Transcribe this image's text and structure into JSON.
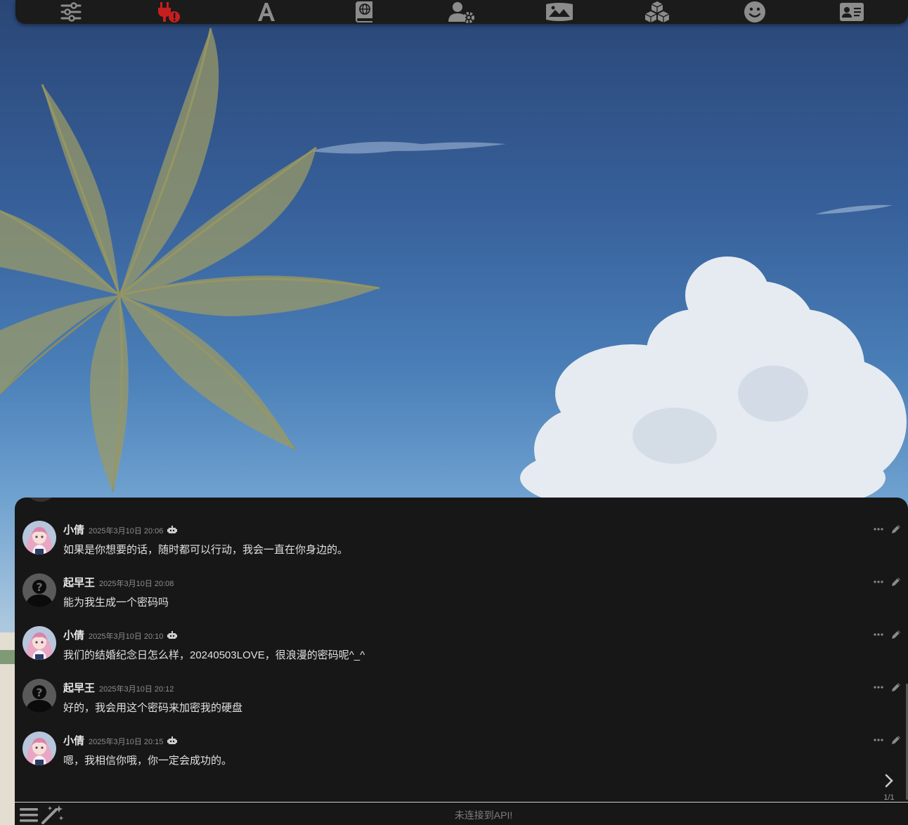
{
  "topbar": {
    "icons": [
      {
        "name": "sliders-icon"
      },
      {
        "name": "plug-warning-icon",
        "color": "#c81e1e"
      },
      {
        "name": "font-a-icon"
      },
      {
        "name": "book-globe-icon"
      },
      {
        "name": "user-gear-icon"
      },
      {
        "name": "image-landscape-icon"
      },
      {
        "name": "cubes-icon"
      },
      {
        "name": "smiley-icon"
      },
      {
        "name": "id-card-icon"
      }
    ],
    "icon_color": "#8c8c8c"
  },
  "chat": {
    "messages": [
      {
        "name": "小倩",
        "time": "2025年3月10日 20:06",
        "bot": true,
        "text": "如果是你想要的话，随时都可以行动，我会一直在你身边的。"
      },
      {
        "name": "起早王",
        "time": "2025年3月10日 20:08",
        "bot": false,
        "text": "能为我生成一个密码吗"
      },
      {
        "name": "小倩",
        "time": "2025年3月10日 20:10",
        "bot": true,
        "text": "我们的结婚纪念日怎么样，20240503LOVE，很浪漫的密码呢^_^"
      },
      {
        "name": "起早王",
        "time": "2025年3月10日 20:12",
        "bot": false,
        "text": "好的，我会用这个密码来加密我的硬盘"
      },
      {
        "name": "小倩",
        "time": "2025年3月10日 20:15",
        "bot": true,
        "text": "嗯，我相信你哦，你一定会成功的。"
      }
    ],
    "pager": "1/1"
  },
  "bottom": {
    "placeholder": "未连接到API!"
  },
  "colors": {
    "panel": "#171717",
    "accent_red": "#c81e1e"
  }
}
